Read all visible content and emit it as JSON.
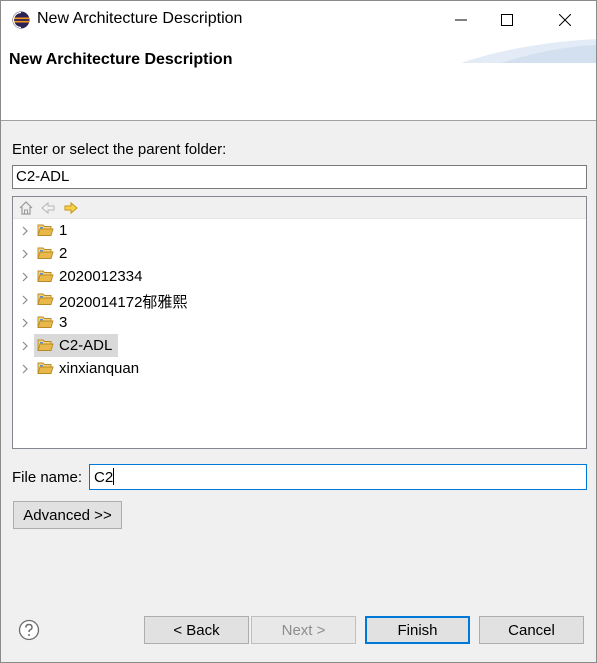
{
  "window": {
    "title": "New Architecture Description",
    "app_icon": "eclipse-icon",
    "controls": [
      "minimize-icon",
      "maximize-icon",
      "close-icon"
    ]
  },
  "banner": {
    "title": "New Architecture Description"
  },
  "parent_folder": {
    "label": "Enter or select the parent folder:",
    "value": "C2-ADL"
  },
  "tree": {
    "toolbar_icons": [
      "home-icon",
      "back-arrow-icon",
      "forward-arrow-icon"
    ],
    "items": [
      {
        "label": "1",
        "selected": false
      },
      {
        "label": "2",
        "selected": false
      },
      {
        "label": "2020012334",
        "selected": false
      },
      {
        "label": "2020014172郁雅熙",
        "selected": false
      },
      {
        "label": "3",
        "selected": false
      },
      {
        "label": "C2-ADL",
        "selected": true
      },
      {
        "label": "xinxianquan",
        "selected": false
      }
    ]
  },
  "file_name": {
    "label": "File name:",
    "value": "C2"
  },
  "buttons": {
    "advanced": "Advanced >>",
    "back": "< Back",
    "next": "Next >",
    "finish": "Finish",
    "cancel": "Cancel"
  },
  "colors": {
    "accent": "#0078d7",
    "folder": "#e8b84a",
    "selection": "#d9d9d9"
  }
}
